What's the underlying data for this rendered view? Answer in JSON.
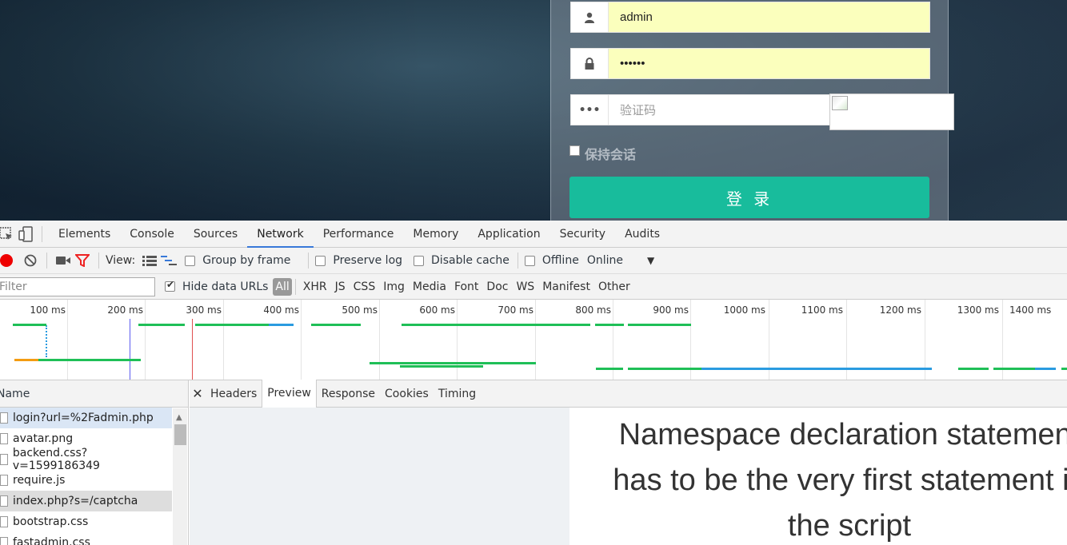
{
  "login": {
    "username": "admin",
    "password_mask": "••••••",
    "captcha_placeholder": "验证码",
    "keep_session": "保持会话",
    "submit": "登 录"
  },
  "devtools": {
    "tabs": [
      "Elements",
      "Console",
      "Sources",
      "Network",
      "Performance",
      "Memory",
      "Application",
      "Security",
      "Audits"
    ],
    "active_tab": "Network",
    "toolbar": {
      "view_label": "View:",
      "group_by_frame": "Group by frame",
      "preserve_log": "Preserve log",
      "disable_cache": "Disable cache",
      "offline": "Offline",
      "throttle": "Online"
    },
    "filter": {
      "placeholder": "Filter",
      "hide_data_urls": "Hide data URLs",
      "types": [
        "All",
        "XHR",
        "JS",
        "CSS",
        "Img",
        "Media",
        "Font",
        "Doc",
        "WS",
        "Manifest",
        "Other"
      ]
    },
    "timeline_ticks": [
      "100 ms",
      "200 ms",
      "300 ms",
      "400 ms",
      "500 ms",
      "600 ms",
      "700 ms",
      "800 ms",
      "900 ms",
      "1000 ms",
      "1100 ms",
      "1200 ms",
      "1300 ms",
      "1400 ms"
    ],
    "requests": {
      "header": "Name",
      "items": [
        "login?url=%2Fadmin.php",
        "avatar.png",
        "backend.css?v=1599186349",
        "require.js",
        "index.php?s=/captcha",
        "bootstrap.css",
        "fastadmin.css"
      ]
    },
    "detail_tabs": [
      "Headers",
      "Preview",
      "Response",
      "Cookies",
      "Timing"
    ],
    "active_detail_tab": "Preview",
    "preview_text": "Namespace declaration statement has to be the very first statement in the script",
    "colors": {
      "accent": "#3879d9",
      "login_button": "#18bc9c",
      "record": "#ee0000",
      "bar_green": "#1fbf57",
      "bar_blue": "#2a9be0",
      "bar_orange": "#f39c12"
    }
  }
}
